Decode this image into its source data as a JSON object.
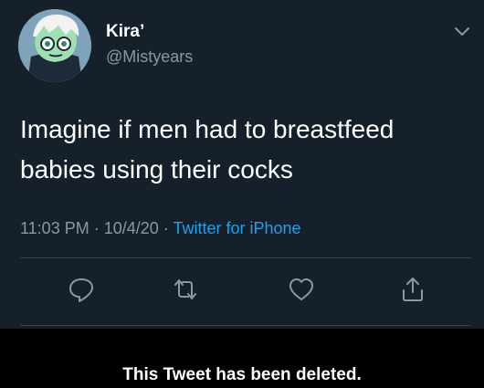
{
  "tweet": {
    "author_name": "Kira’",
    "author_handle": "@Mistyears",
    "text_line1": "Imagine if men had to breastfeed",
    "text_line2": "babies using their cocks",
    "time": "11:03 PM",
    "date": "10/4/20",
    "source": "Twitter for iPhone",
    "separator": " · ",
    "avatar_icon": "cartoon-avatar-icon"
  },
  "actions": {
    "reply_icon": "reply-icon",
    "retweet_icon": "retweet-icon",
    "like_icon": "heart-icon",
    "share_icon": "share-icon"
  },
  "notice": {
    "deleted_text": "This Tweet has been deleted."
  },
  "colors": {
    "background": "#15202b",
    "secondary_text": "#8899a6",
    "link": "#1da1f2",
    "divider": "#38444d"
  }
}
